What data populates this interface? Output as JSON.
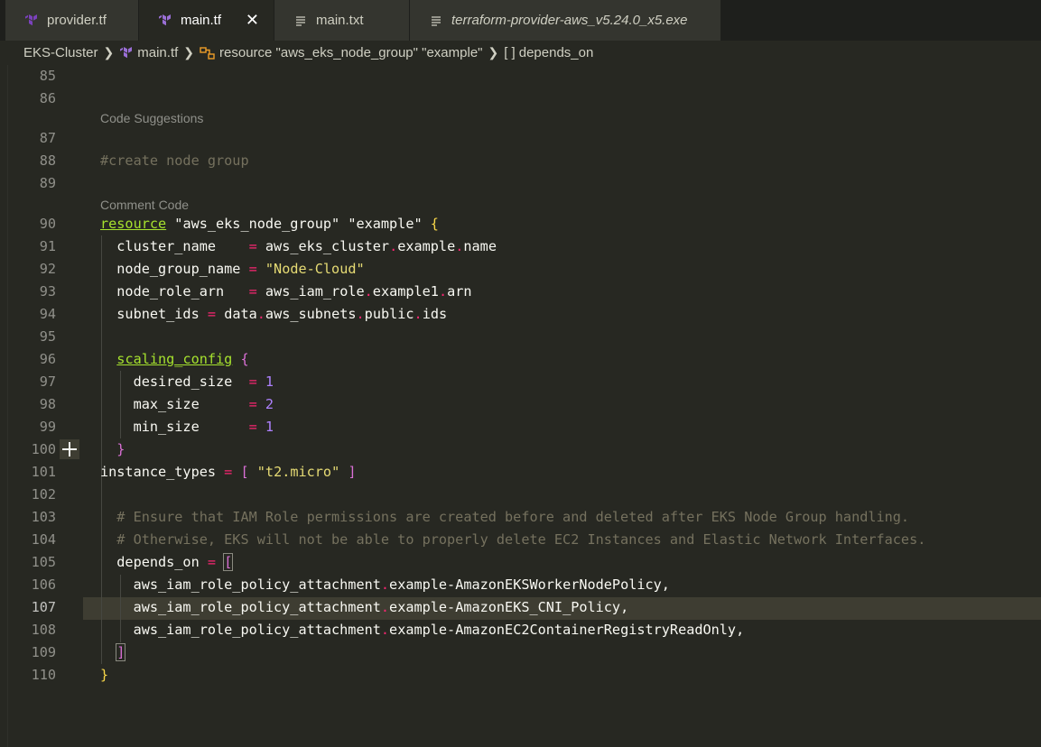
{
  "tabs": [
    {
      "label": "provider.tf",
      "icon": "terraform-icon",
      "active": false
    },
    {
      "label": "main.tf",
      "icon": "terraform-icon",
      "active": true,
      "close": "✕"
    },
    {
      "label": "main.txt",
      "icon": "text-file-icon",
      "active": false
    },
    {
      "label": "terraform-provider-aws_v5.24.0_x5.exe",
      "icon": "text-file-icon",
      "active": false
    }
  ],
  "breadcrumb": {
    "folder": "EKS-Cluster",
    "file": "main.tf",
    "resource": "resource \"aws_eks_node_group\" \"example\"",
    "property": "depends_on",
    "property_icon": "[ ]"
  },
  "codelens": {
    "suggestions": "Code Suggestions",
    "comment": "Comment Code"
  },
  "line_numbers": {
    "l85": "85",
    "l86": "86",
    "l87": "87",
    "l88": "88",
    "l89": "89",
    "l90": "90",
    "l91": "91",
    "l92": "92",
    "l93": "93",
    "l94": "94",
    "l95": "95",
    "l96": "96",
    "l97": "97",
    "l98": "98",
    "l99": "99",
    "l100": "100",
    "l101": "101",
    "l102": "102",
    "l103": "103",
    "l104": "104",
    "l105": "105",
    "l106": "106",
    "l107": "107",
    "l108": "108",
    "l109": "109",
    "l110": "110"
  },
  "code": {
    "c88": "#create node group",
    "c90_kw": "resource",
    "c90_a": " \"aws_eks_node_group\" \"example\" ",
    "c90_b": "{",
    "c91_a": "  cluster_name    ",
    "c91_b": "aws_eks_cluster",
    "c91_c": "example",
    "c91_d": "name",
    "c92_a": "  node_group_name ",
    "c92_b": "\"Node-Cloud\"",
    "c93_a": "  node_role_arn   ",
    "c93_b": "aws_iam_role",
    "c93_c": "example1",
    "c93_d": "arn",
    "c94_a": "  subnet_ids ",
    "c94_b": "data",
    "c94_c": "aws_subnets",
    "c94_d": "public",
    "c94_e": "ids",
    "c96_kw": "scaling_config",
    "c96_b": "{",
    "c97_a": "    desired_size  ",
    "c97_b": "1",
    "c98_a": "    max_size      ",
    "c98_b": "2",
    "c99_a": "    min_size      ",
    "c99_b": "1",
    "c100": "}",
    "c101_a": "instance_types ",
    "c101_b": "[",
    "c101_c": "\"t2.micro\"",
    "c101_d": "]",
    "c103": "  # Ensure that IAM Role permissions are created before and deleted after EKS Node Group handling.",
    "c104": "  # Otherwise, EKS will not be able to properly delete EC2 Instances and Elastic Network Interfaces.",
    "c105_a": "  depends_on ",
    "c105_b": "[",
    "c106_a": "    aws_iam_role_policy_attachment",
    "c106_b": "example-AmazonEKSWorkerNodePolicy,",
    "c107_a": "    aws_iam_role_policy_attachment",
    "c107_b": "example-AmazonEKS_CNI_Policy,",
    "c108_a": "    aws_iam_role_policy_attachment",
    "c108_b": "example-AmazonEC2ContainerRegistryReadOnly,",
    "c109": "]",
    "c110": "}"
  },
  "ops": {
    "eq": "=",
    "dot": "."
  },
  "colors": {
    "background": "#272822",
    "keyword": "#a6e22e",
    "string": "#e6db74",
    "number": "#ae81ff",
    "operator": "#f92672",
    "comment": "#75715e",
    "bracket_gold": "#f9d849",
    "bracket_magenta": "#da70d6",
    "current_line": "#3e3d32"
  }
}
